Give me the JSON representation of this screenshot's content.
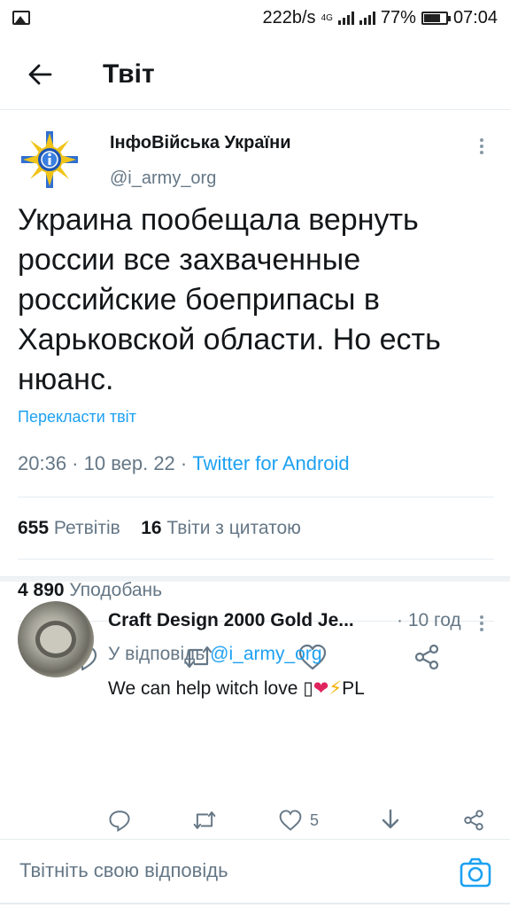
{
  "status_bar": {
    "speed": "222b/s",
    "network": "4G",
    "battery_percent": "77%",
    "battery_level": 0.77,
    "time": "07:04"
  },
  "header": {
    "title": "Твіт",
    "back_icon": "arrow-left-icon"
  },
  "tweet": {
    "author_name": "ІнфоВійська України",
    "author_handle": "@i_army_org",
    "avatar_icon": "army-emblem-icon",
    "text": "Украина пообещала вернуть россии все захваченные российские боеприпасы в Харьковской области. Но есть нюанс.",
    "translate_label": "Перекласти твіт",
    "timestamp": "20:36 · 10 вер. 22 · ",
    "source": "Twitter for Android",
    "retweets_count": "655",
    "retweets_label": "Ретвітів",
    "quotes_count": "16",
    "quotes_label": "Твіти з цитатою",
    "likes_count": "4 890",
    "likes_label": "Уподобань"
  },
  "reply": {
    "author_name": "Craft Design 2000 Gold Je...",
    "time": "· 10 год",
    "in_reply_prefix": "У відповідь ",
    "in_reply_mention": "@i_army_org",
    "text_start": "We can help witch love ",
    "text_glyph": "▯",
    "text_heart": "❤",
    "text_bolt": "⚡",
    "text_end": "PL",
    "likes_count": "5"
  },
  "compose": {
    "placeholder": "Твітніть свою відповідь",
    "camera_icon": "camera-icon"
  },
  "colors": {
    "accent": "#1da1f2",
    "muted": "#657786",
    "text": "#14171a",
    "divider": "#e6ecf0"
  }
}
